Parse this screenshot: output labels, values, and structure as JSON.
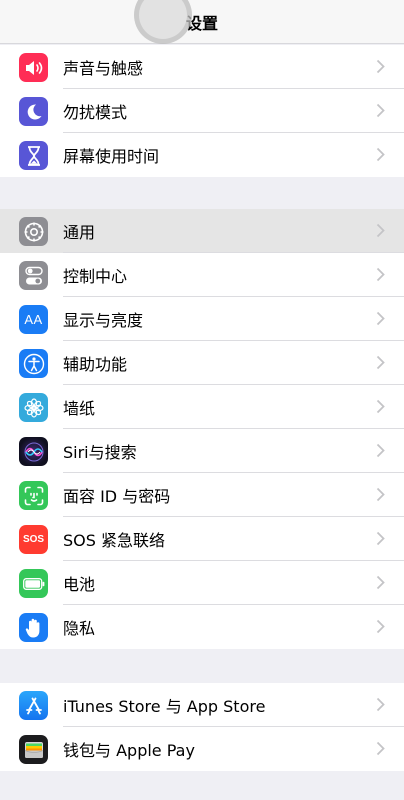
{
  "nav": {
    "title": "设置"
  },
  "groups": [
    {
      "rows": [
        {
          "label": "声音与触感",
          "icon": "speaker-icon",
          "color": "#ff2d55"
        },
        {
          "label": "勿扰模式",
          "icon": "moon-icon",
          "color": "#5856d6"
        },
        {
          "label": "屏幕使用时间",
          "icon": "hourglass-icon",
          "color": "#5856d6"
        }
      ]
    },
    {
      "rows": [
        {
          "label": "通用",
          "icon": "gear-icon",
          "color": "#8e8e93",
          "highlighted": true
        },
        {
          "label": "控制中心",
          "icon": "toggles-icon",
          "color": "#8e8e93"
        },
        {
          "label": "显示与亮度",
          "icon": "text-size-icon",
          "icon_text": "AA",
          "color": "#1a7cf5"
        },
        {
          "label": "辅助功能",
          "icon": "accessibility-icon",
          "color": "#1a7cf5"
        },
        {
          "label": "墙纸",
          "icon": "flower-icon",
          "color": "#34aadc"
        },
        {
          "label": "Siri与搜索",
          "icon": "siri-icon",
          "color": "#1c1c2e"
        },
        {
          "label": "面容 ID 与密码",
          "icon": "face-id-icon",
          "color": "#34c759"
        },
        {
          "label": "SOS 紧急联络",
          "icon": "sos-icon",
          "icon_text": "SOS",
          "color": "#ff3b30"
        },
        {
          "label": "电池",
          "icon": "battery-icon",
          "color": "#34c759"
        },
        {
          "label": "隐私",
          "icon": "hand-icon",
          "color": "#1a7cf5"
        }
      ]
    },
    {
      "rows": [
        {
          "label": "iTunes Store 与 App Store",
          "icon": "app-store-icon",
          "color": "#1a8cf7"
        },
        {
          "label": "钱包与 Apple Pay",
          "icon": "wallet-icon",
          "color": "#1c1c1e"
        }
      ]
    }
  ]
}
